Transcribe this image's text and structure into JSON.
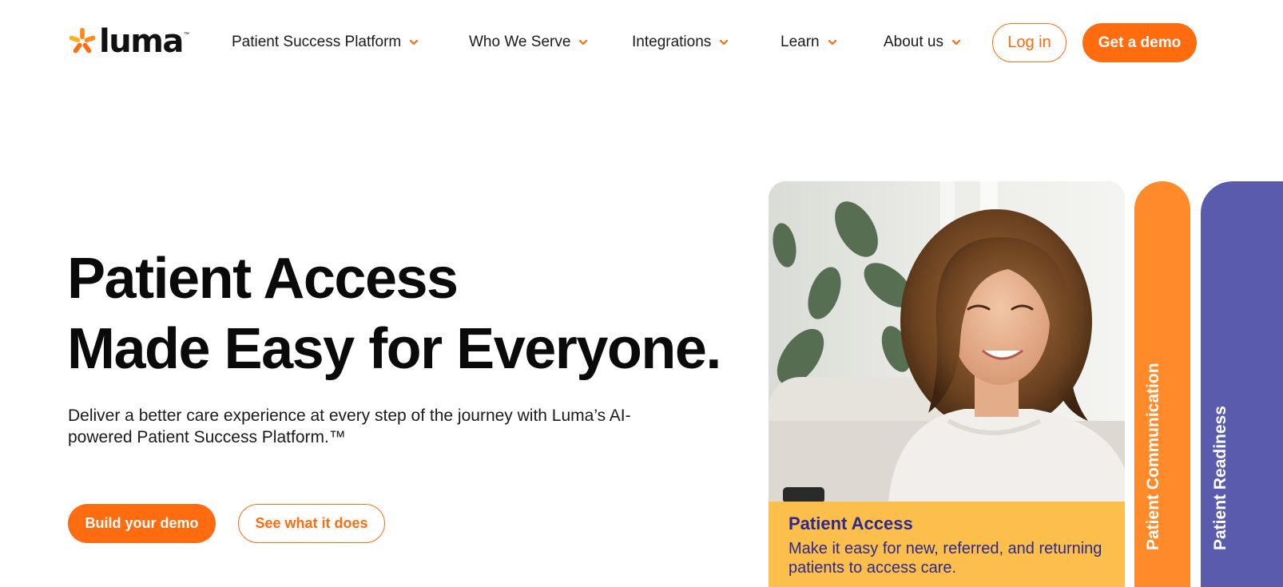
{
  "header": {
    "logo": {
      "text": "luma",
      "tm": "™",
      "star_color": "#ff8a1a"
    },
    "nav": [
      {
        "label": "Patient Success Platform"
      },
      {
        "label": "Who We Serve"
      },
      {
        "label": "Integrations"
      },
      {
        "label": "Learn"
      },
      {
        "label": "About us"
      }
    ],
    "login_label": "Log in",
    "demo_label": "Get a demo"
  },
  "hero": {
    "title_line1": "Patient Access",
    "title_line2": "Made Easy for Everyone.",
    "subtitle": "Deliver a better care experience at every step of the journey with Luma’s AI-powered Patient Success Platform.™",
    "build_label": "Build your demo",
    "see_label": "See what it does"
  },
  "cards": {
    "main": {
      "title": "Patient Access",
      "text": "Make it easy for new, referred, and returning patients to access care."
    },
    "tabs": [
      {
        "label": "Patient Communication"
      },
      {
        "label": "Patient Readiness"
      }
    ]
  },
  "colors": {
    "accent": "#ff6b0f",
    "card_yellow": "#fdbf4c",
    "card_text": "#2e2a8c",
    "pill_orange": "#ff8a2a",
    "pill_purple": "#5b5bad"
  }
}
